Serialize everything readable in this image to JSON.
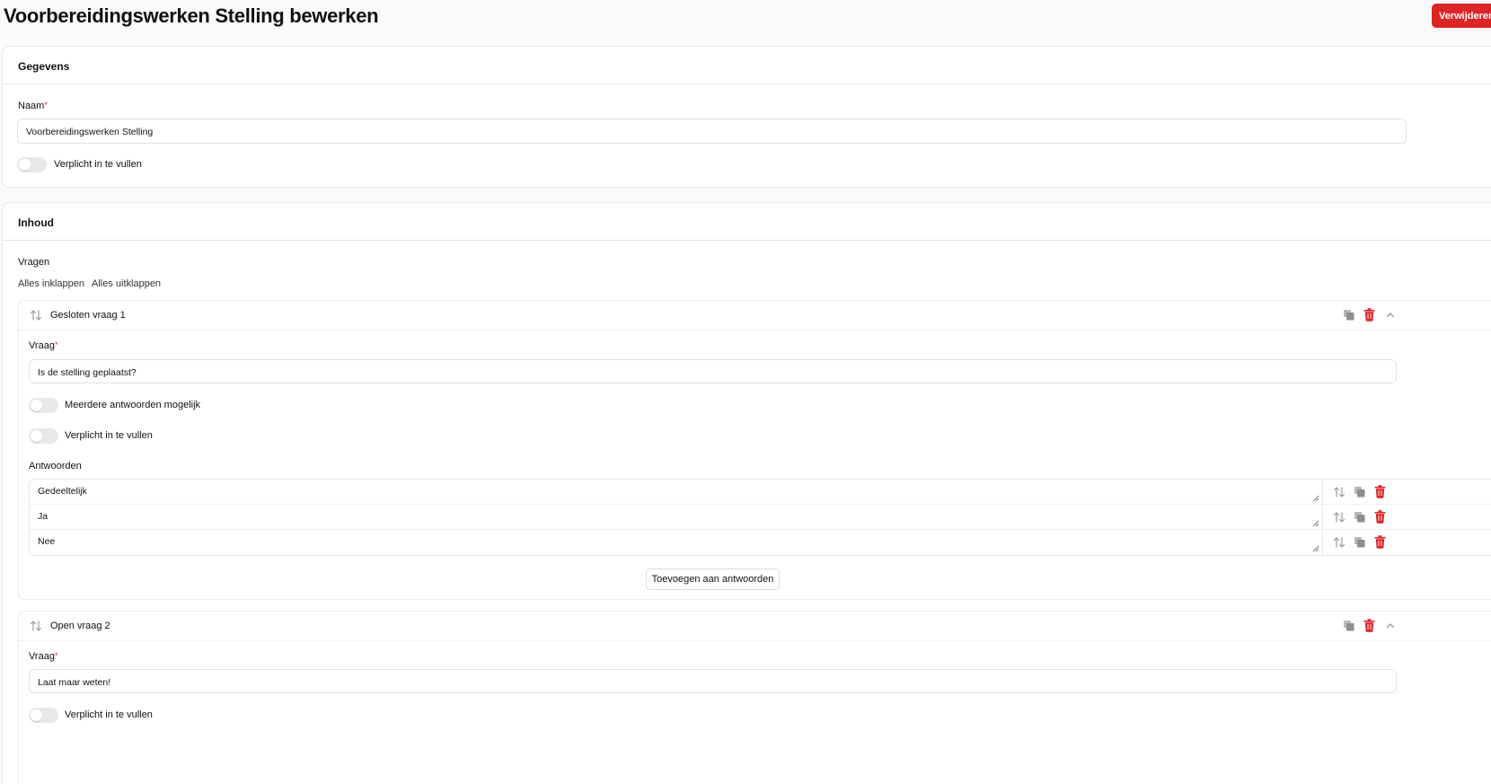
{
  "header": {
    "title": "Voorbereidingswerken Stelling bewerken",
    "delete_label": "Verwijderen"
  },
  "gegevens": {
    "title": "Gegevens",
    "name_label": "Naam",
    "required_marker": "*",
    "name_value": "Voorbereidingswerken Stelling",
    "required_toggle_label": "Verplicht in te vullen",
    "required_toggle_on": false
  },
  "inhoud": {
    "title": "Inhoud",
    "questions_label": "Vragen",
    "collapse_all": "Alles inklappen",
    "expand_all": "Alles uitklappen",
    "questions": [
      {
        "title": "Gesloten vraag 1",
        "question_label": "Vraag",
        "question_value": "Is de stelling geplaatst?",
        "multiple_label": "Meerdere antwoorden mogelijk",
        "multiple_on": false,
        "required_label": "Verplicht in te vullen",
        "required_on": false,
        "answers_label": "Antwoorden",
        "answers": [
          "Gedeeltelijk",
          "Ja",
          "Nee"
        ],
        "add_answer_label": "Toevoegen aan antwoorden"
      },
      {
        "title": "Open vraag 2",
        "question_label": "Vraag",
        "question_value": "Laat maar weten!",
        "required_label": "Verplicht in te vullen",
        "required_on": false
      }
    ]
  },
  "colors": {
    "danger": "#dc2626",
    "icon_gray": "#9a9a9a",
    "border": "#e6e6e6"
  },
  "icons": [
    "sort-arrows-icon",
    "copy-icon",
    "trash-icon",
    "chevron-up-icon",
    "resize-handle-icon"
  ]
}
